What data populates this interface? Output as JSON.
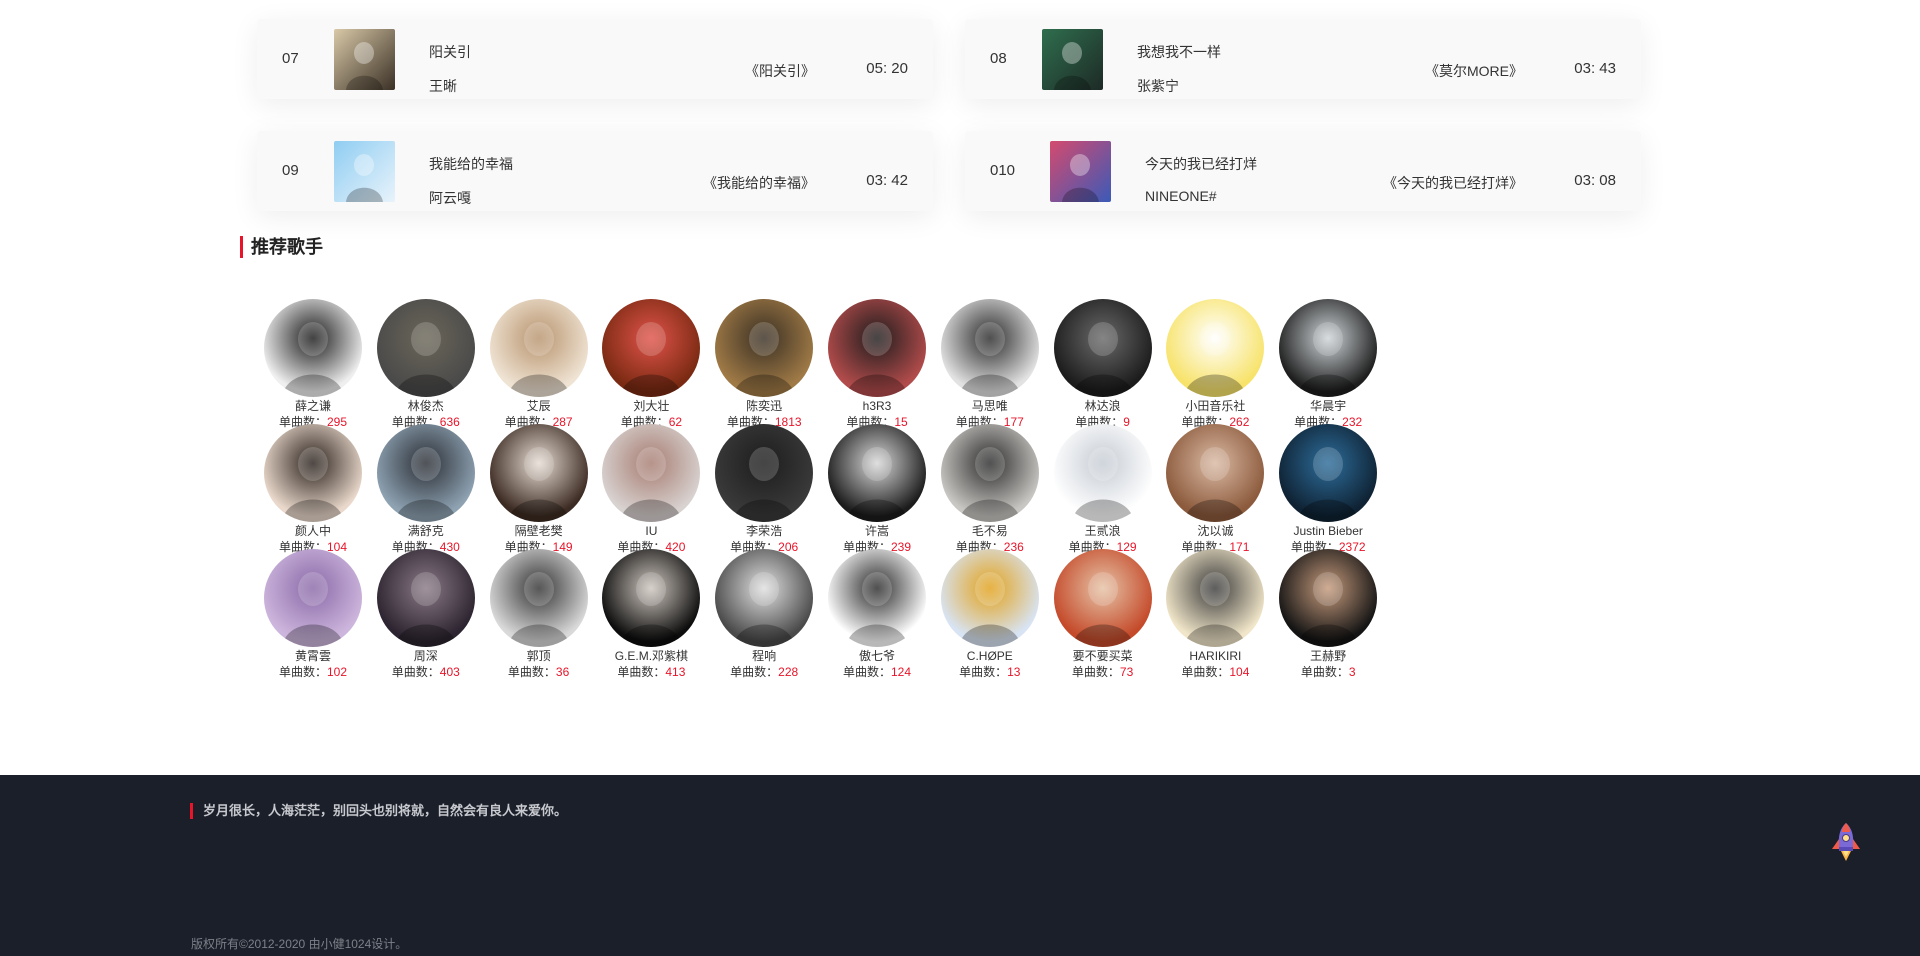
{
  "songs": [
    {
      "num": "07",
      "title": "阳关引",
      "artist": "王晰",
      "album": "《阳关引》",
      "duration": "05: 20",
      "cover_colors": [
        "#d9c9a8",
        "#3a3025"
      ]
    },
    {
      "num": "08",
      "title": "我想我不一样",
      "artist": "张紫宁",
      "album": "《莫尔MORE》",
      "duration": "03: 43",
      "cover_colors": [
        "#2f6e4e",
        "#1d2a26"
      ]
    },
    {
      "num": "09",
      "title": "我能给的幸福",
      "artist": "阿云嘎",
      "album": "《我能给的幸福》",
      "duration": "03: 42",
      "cover_colors": [
        "#8fcdf2",
        "#e8f3fb"
      ]
    },
    {
      "num": "010",
      "title": "今天的我已经打烊",
      "artist": "NINEONE#",
      "album": "《今天的我已经打烊》",
      "duration": "03: 08",
      "cover_colors": [
        "#d44a6e",
        "#3b5ab8"
      ]
    }
  ],
  "section_title": "推荐歌手",
  "count_label": "单曲数：",
  "singers": [
    {
      "name": "薛之谦",
      "count": "295",
      "colors": [
        "#efefef",
        "#1a1a1a"
      ]
    },
    {
      "name": "林俊杰",
      "count": "636",
      "colors": [
        "#4a4a4a",
        "#6b6658"
      ]
    },
    {
      "name": "艾辰",
      "count": "287",
      "colors": [
        "#efe3d3",
        "#b8946e"
      ]
    },
    {
      "name": "刘大壮",
      "count": "62",
      "colors": [
        "#7a2a12",
        "#e0534a"
      ]
    },
    {
      "name": "陈奕迅",
      "count": "1813",
      "colors": [
        "#a07a46",
        "#3a3024"
      ]
    },
    {
      "name": "h3R3",
      "count": "15",
      "colors": [
        "#b24b4b",
        "#1f1d1d"
      ]
    },
    {
      "name": "马思唯",
      "count": "177",
      "colors": [
        "#e2e2e2",
        "#2a2a2a"
      ]
    },
    {
      "name": "林达浪",
      "count": "9",
      "colors": [
        "#1c1c1c",
        "#6a6a6a"
      ]
    },
    {
      "name": "小田音乐社",
      "count": "262",
      "colors": [
        "#f7e36a",
        "#ffffff"
      ]
    },
    {
      "name": "华晨宇",
      "count": "232",
      "colors": [
        "#1e1e1e",
        "#cfd5d8"
      ]
    },
    {
      "name": "颜人中",
      "count": "104",
      "colors": [
        "#e9d8cb",
        "#2a211c"
      ]
    },
    {
      "name": "满舒克",
      "count": "430",
      "colors": [
        "#8ea2b2",
        "#2b2f36"
      ]
    },
    {
      "name": "隔壁老樊",
      "count": "149",
      "colors": [
        "#3c2b22",
        "#e6dcd3"
      ]
    },
    {
      "name": "IU",
      "count": "420",
      "colors": [
        "#d8d2d0",
        "#a77d72"
      ]
    },
    {
      "name": "李荣浩",
      "count": "206",
      "colors": [
        "#3a3a3a",
        "#1d1d1d"
      ]
    },
    {
      "name": "许嵩",
      "count": "239",
      "colors": [
        "#1c1c1c",
        "#d8d8d8"
      ]
    },
    {
      "name": "毛不易",
      "count": "236",
      "colors": [
        "#c9c7c3",
        "#2c2c2c"
      ]
    },
    {
      "name": "王贰浪",
      "count": "129",
      "colors": [
        "#ffffff",
        "#c6ccd4"
      ]
    },
    {
      "name": "沈以诚",
      "count": "171",
      "colors": [
        "#8c5a3c",
        "#d9b9a3"
      ]
    },
    {
      "name": "Justin Bieber",
      "count": "2372",
      "colors": [
        "#0f2233",
        "#2d6d9b"
      ]
    },
    {
      "name": "黄霄雲",
      "count": "102",
      "colors": [
        "#cdb6dd",
        "#8a6aa8"
      ]
    },
    {
      "name": "周深",
      "count": "403",
      "colors": [
        "#2c2430",
        "#8a7a86"
      ]
    },
    {
      "name": "郭顶",
      "count": "36",
      "colors": [
        "#d9d9d9",
        "#333333"
      ]
    },
    {
      "name": "G.E.M.邓紫棋",
      "count": "413",
      "colors": [
        "#0d0d0d",
        "#cfc7bf"
      ]
    },
    {
      "name": "程响",
      "count": "228",
      "colors": [
        "#4a4a4a",
        "#e0e0e0"
      ]
    },
    {
      "name": "傲七爷",
      "count": "124",
      "colors": [
        "#ffffff",
        "#2a2a2a"
      ]
    },
    {
      "name": "C.HØPE",
      "count": "13",
      "colors": [
        "#d8e4f4",
        "#e2a21c"
      ]
    },
    {
      "name": "要不要买菜",
      "count": "73",
      "colors": [
        "#c44a2a",
        "#e6c2a6"
      ]
    },
    {
      "name": "HARIKIRI",
      "count": "104",
      "colors": [
        "#f1e6c9",
        "#3b3b3b"
      ]
    },
    {
      "name": "王赫野",
      "count": "3",
      "colors": [
        "#141414",
        "#c59a7c"
      ]
    }
  ],
  "footer": {
    "quote": "岁月很长，人海茫茫，别回头也别将就，自然会有良人来爱你。",
    "copyright": "版权所有©2012-2020 由小健1024设计。"
  },
  "icons": {
    "back_to_top": "rocket-icon"
  },
  "colors": {
    "accent": "#e8152a",
    "footer_bg": "#1b1f29"
  }
}
